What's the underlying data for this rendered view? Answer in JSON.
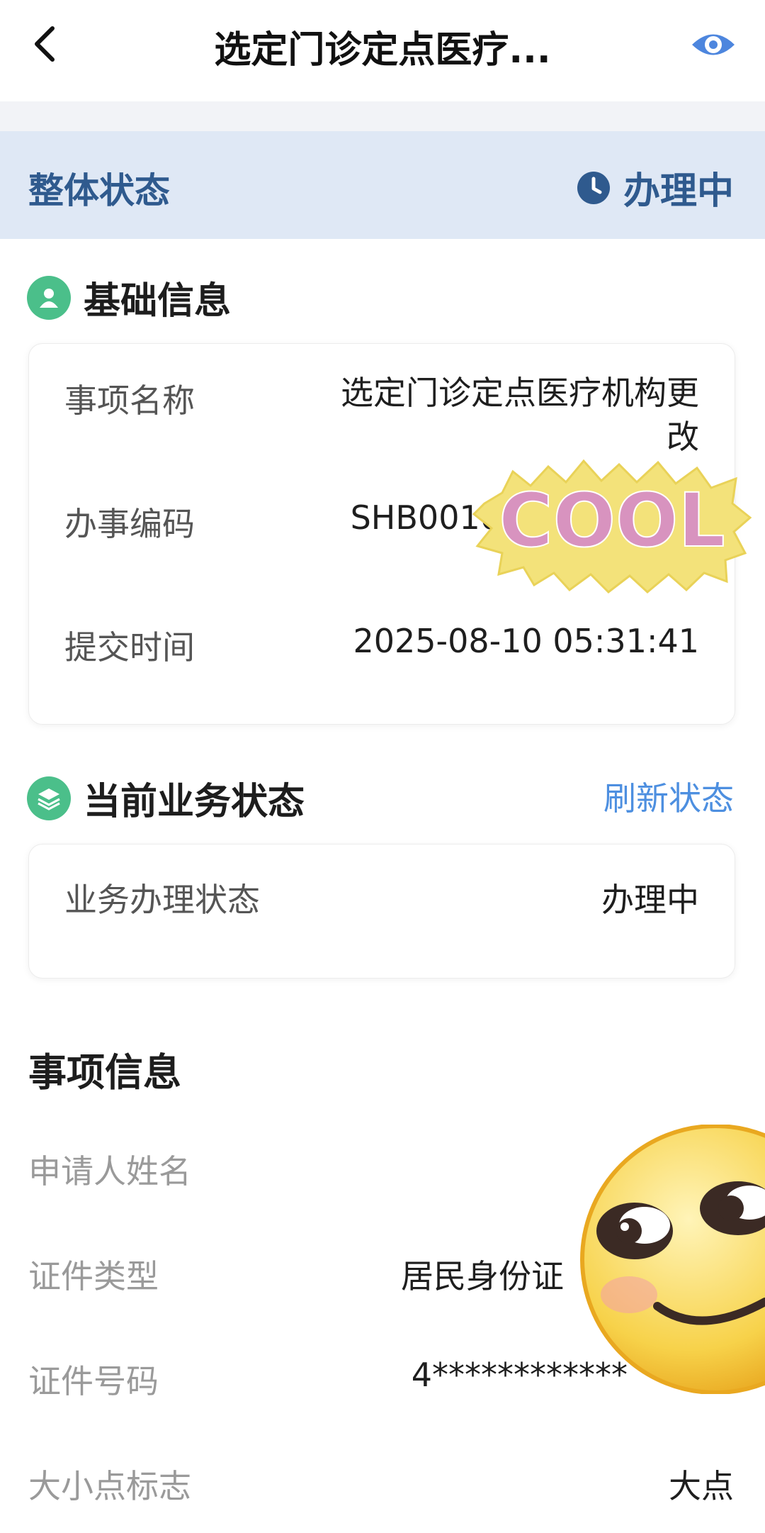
{
  "header": {
    "title": "选定门诊定点医疗...",
    "back_icon": "chevron-left-icon",
    "view_icon": "eye-icon",
    "accent": "#4d86de"
  },
  "overall": {
    "label": "整体状态",
    "value": "办理中",
    "icon": "clock-icon",
    "color": "#2f5a8e"
  },
  "basic": {
    "title": "基础信息",
    "icon": "person-icon",
    "rows": [
      {
        "label": "事项名称",
        "value": "选定门诊定点医疗机构更改"
      },
      {
        "label": "办事编码",
        "value": "SHB0010"
      },
      {
        "label": "提交时间",
        "value": "2025-08-10 05:31:41"
      }
    ]
  },
  "business": {
    "title": "当前业务状态",
    "icon": "layers-icon",
    "refresh_label": "刷新状态",
    "row": {
      "label": "业务办理状态",
      "value": "办理中"
    }
  },
  "item_info": {
    "title": "事项信息",
    "rows": [
      {
        "label": "申请人姓名",
        "value": ""
      },
      {
        "label": "证件类型",
        "value": "居民身份证"
      },
      {
        "label": "证件号码",
        "value": "4************"
      },
      {
        "label": "大小点标志",
        "value": "大点"
      }
    ]
  },
  "stickers": {
    "cool_text": "COOL"
  }
}
